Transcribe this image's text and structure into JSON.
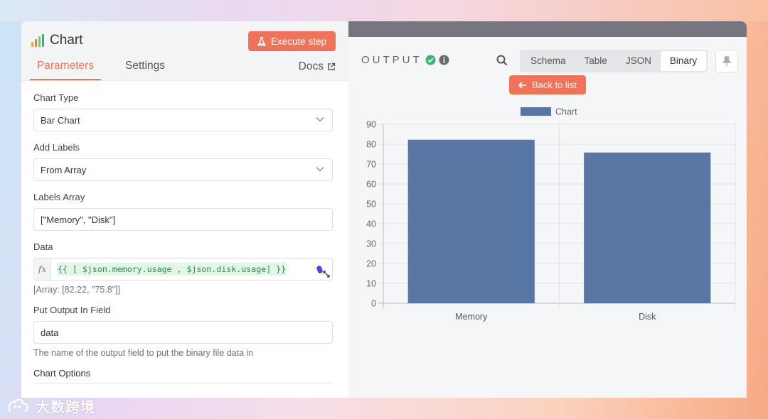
{
  "node": {
    "title": "Chart",
    "execute_label": "Execute step",
    "tabs": [
      {
        "label": "Parameters"
      },
      {
        "label": "Settings"
      }
    ],
    "docs_label": "Docs"
  },
  "params": {
    "chart_type": {
      "label": "Chart Type",
      "value": "Bar Chart"
    },
    "add_labels": {
      "label": "Add Labels",
      "value": "From Array"
    },
    "labels_array": {
      "label": "Labels Array",
      "value": "[\"Memory\", \"Disk\"]"
    },
    "data": {
      "label": "Data",
      "fx": "fx",
      "expression": "{{ [ $json.memory.usage , $json.disk.usage] }}",
      "result": "[Array: [82.22, \"75.8\"]]"
    },
    "output_field": {
      "label": "Put Output In Field",
      "value": "data",
      "hint": "The name of the output field to put the binary file data in"
    },
    "chart_options": {
      "label": "Chart Options"
    }
  },
  "output": {
    "label": "OUTPUT",
    "view_tabs": [
      {
        "label": "Schema"
      },
      {
        "label": "Table"
      },
      {
        "label": "JSON"
      },
      {
        "label": "Binary"
      }
    ],
    "active_tab": "Binary",
    "back_label": "Back to list"
  },
  "colors": {
    "accent": "#f07258",
    "bar": "#5977a5",
    "success": "#3bb371"
  },
  "chart_data": {
    "type": "bar",
    "categories": [
      "Memory",
      "Disk"
    ],
    "series": [
      {
        "name": "Chart",
        "values": [
          82.22,
          75.8
        ]
      }
    ],
    "ylim": [
      0,
      90
    ],
    "yticks": [
      0,
      10,
      20,
      30,
      40,
      50,
      60,
      70,
      80,
      90
    ],
    "grid": true,
    "legend": "top-center"
  },
  "watermark": {
    "text": "大数跨境"
  }
}
